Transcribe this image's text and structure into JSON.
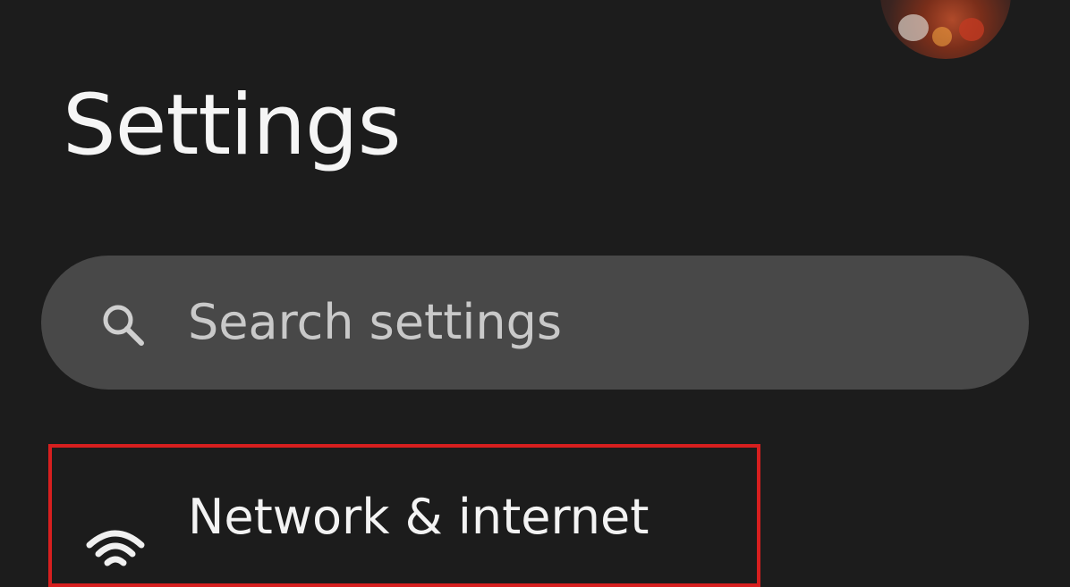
{
  "header": {
    "title": "Settings",
    "avatar_icon": "user-avatar"
  },
  "search": {
    "placeholder": "Search settings",
    "icon": "search-icon"
  },
  "settings_items": [
    {
      "label": "Network & internet",
      "icon": "wifi-icon",
      "highlighted": true
    }
  ],
  "colors": {
    "background": "#1c1c1c",
    "search_bar": "#484848",
    "highlight_border": "#d61f1f",
    "text_primary": "#f3f3f3",
    "text_secondary": "#c9c9c9"
  }
}
